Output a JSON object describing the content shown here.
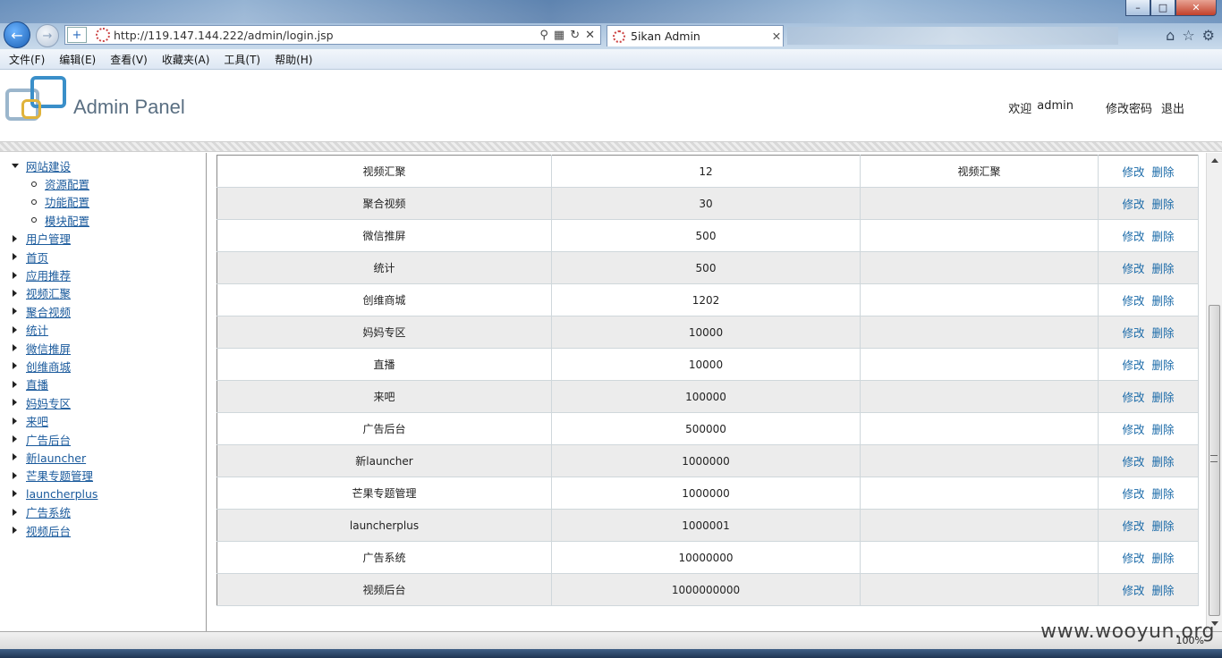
{
  "browser": {
    "url": "http://119.147.144.222/admin/login.jsp",
    "tab_title": "5ikan Admin",
    "menu": [
      "文件(F)",
      "编辑(E)",
      "查看(V)",
      "收藏夹(A)",
      "工具(T)",
      "帮助(H)"
    ],
    "zoom": "100%"
  },
  "header": {
    "brand": "Admin Panel",
    "welcome": "欢迎",
    "username": "admin",
    "change_password": "修改密码",
    "logout": "退出"
  },
  "sidebar": {
    "expanded": "网站建设",
    "sub_items": [
      "资源配置",
      "功能配置",
      "模块配置"
    ],
    "items": [
      "用户管理",
      "首页",
      "应用推荐",
      "视频汇聚",
      "聚合视频",
      "统计",
      "微信推屏",
      "创维商城",
      "直播",
      "妈妈专区",
      "来吧",
      "广告后台",
      "新launcher",
      "芒果专题管理",
      "launcherplus",
      "广告系统",
      "视频后台"
    ]
  },
  "table": {
    "edit_label": "修改",
    "delete_label": "删除",
    "rows": [
      {
        "name": "视频汇聚",
        "value": "12",
        "note": "视频汇聚"
      },
      {
        "name": "聚合视频",
        "value": "30",
        "note": ""
      },
      {
        "name": "微信推屏",
        "value": "500",
        "note": ""
      },
      {
        "name": "统计",
        "value": "500",
        "note": ""
      },
      {
        "name": "创维商城",
        "value": "1202",
        "note": ""
      },
      {
        "name": "妈妈专区",
        "value": "10000",
        "note": ""
      },
      {
        "name": "直播",
        "value": "10000",
        "note": ""
      },
      {
        "name": "来吧",
        "value": "100000",
        "note": ""
      },
      {
        "name": "广告后台",
        "value": "500000",
        "note": ""
      },
      {
        "name": "新launcher",
        "value": "1000000",
        "note": ""
      },
      {
        "name": "芒果专题管理",
        "value": "1000000",
        "note": ""
      },
      {
        "name": "launcherplus",
        "value": "1000001",
        "note": ""
      },
      {
        "name": "广告系统",
        "value": "10000000",
        "note": ""
      },
      {
        "name": "视频后台",
        "value": "1000000000",
        "note": ""
      }
    ]
  },
  "watermark": "www.wooyun.org"
}
